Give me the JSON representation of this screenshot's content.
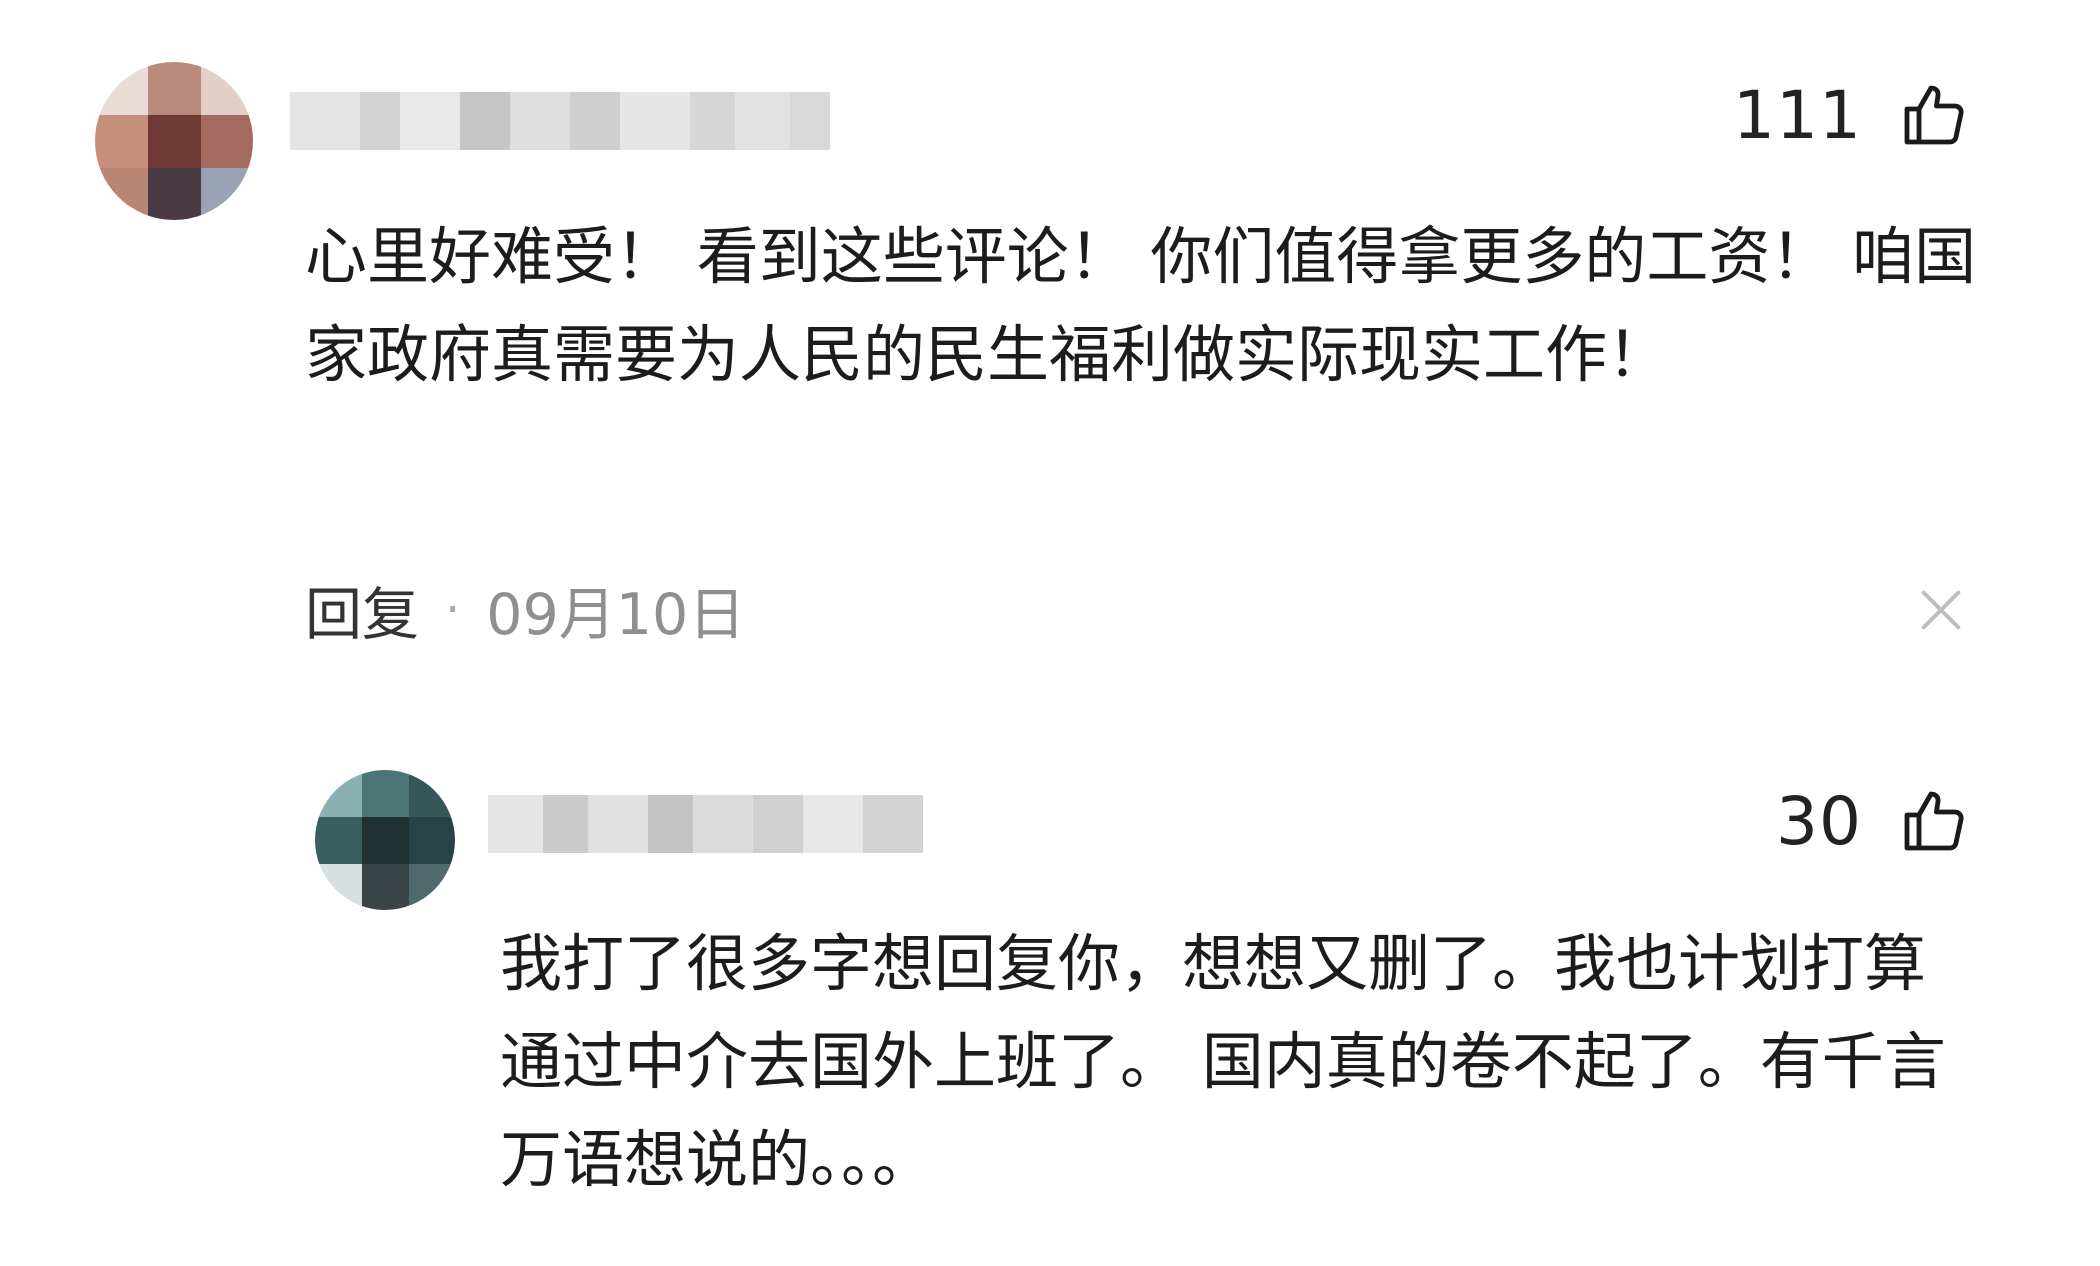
{
  "comment": {
    "likes": "111",
    "text": "心里好难受！ 看到这些评论！ 你们值得拿更多的工资！ 咱国家政府真需要为人民的民生福利做实际现实工作！",
    "reply_label": "回复",
    "separator": "·",
    "date": "09月10日"
  },
  "reply": {
    "likes": "30",
    "text": "我打了很多字想回复你，想想又删了。我也计划打算通过中介去国外上班了。 国内真的卷不起了。有千言万语想说的。。。"
  },
  "icons": {
    "like": "thumbs-up-icon",
    "close": "close-icon"
  }
}
